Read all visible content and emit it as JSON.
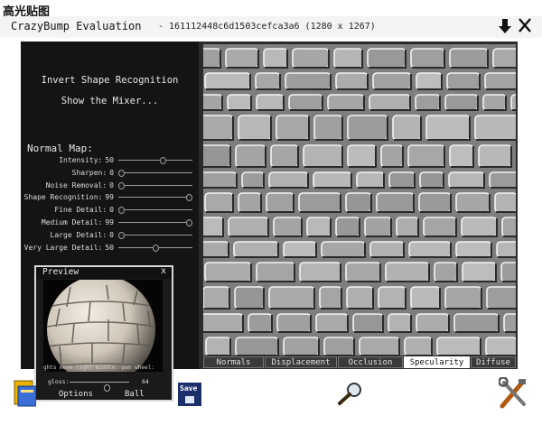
{
  "caption": "高光贴图",
  "window": {
    "app_title": "CrazyBump Evaluation",
    "file_info": "- 161112448c6d1503cefca3a6 (1280 x 1267)"
  },
  "menu": {
    "invert_shape": "Invert Shape Recognition",
    "show_mixer": "Show the Mixer..."
  },
  "normal_map": {
    "title": "Normal Map:",
    "sliders": [
      {
        "label": "Intensity:",
        "value": "50",
        "level": 0.6
      },
      {
        "label": "Sharpen:",
        "value": "0",
        "level": 0.0
      },
      {
        "label": "Noise Removal:",
        "value": "0",
        "level": 0.0
      },
      {
        "label": "Shape Recognition:",
        "value": "99",
        "level": 0.99
      },
      {
        "label": "Fine Detail:",
        "value": "0",
        "level": 0.0
      },
      {
        "label": "Medium Detail:",
        "value": "99",
        "level": 0.99
      },
      {
        "label": "Large Detail:",
        "value": "0",
        "level": 0.0
      },
      {
        "label": "Very Large Detail:",
        "value": "50",
        "level": 0.5
      }
    ]
  },
  "tabs": [
    {
      "label": "Normals",
      "active": false
    },
    {
      "label": "Displacement",
      "active": false
    },
    {
      "label": "Occlusion",
      "active": false
    },
    {
      "label": "Specularity",
      "active": true
    },
    {
      "label": "Diffuse",
      "active": false
    }
  ],
  "preview": {
    "title": "Preview",
    "close": "x",
    "hints": "ghts   move light      middle: pan      wheel:",
    "gloss_label": "gloss:",
    "gloss_value": "64",
    "gloss_level": 0.64,
    "options_label": "Options",
    "ball_label": "Ball"
  },
  "toolbar": {
    "save_label": "Save"
  },
  "icons": {
    "down": "arrow-down-icon",
    "close": "close-icon",
    "open": "open-folder-icon",
    "zoom": "magnifier-icon",
    "tools": "tools-icon"
  }
}
